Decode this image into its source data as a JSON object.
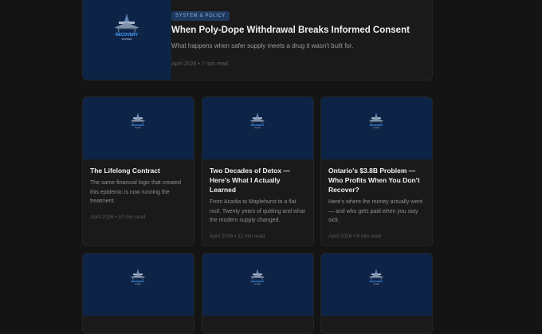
{
  "logo": {
    "wordmark": "RECOVERY",
    "sub": "ROOFER"
  },
  "featured": {
    "badge": "SYSTEM & POLICY",
    "title": "When Poly-Dope Withdrawal Breaks Informed Consent",
    "excerpt": "What happens when safer supply meets a drug it wasn't built for.",
    "meta": "April 2026 • 7 min read"
  },
  "cards": [
    {
      "title": "The Lifelong Contract",
      "excerpt": "The same financial logic that created this epidemic is now running the treatment.",
      "meta": "April 2026 • 10 min read"
    },
    {
      "title": "Two Decades of Detox — Here's What I Actually Learned",
      "excerpt": "From Acadia to Maplehurst to a flat roof. Twenty years of quitting and what the modern supply changed.",
      "meta": "April 2026 • 11 min read"
    },
    {
      "title": "Ontario's $3.8B Problem — Who Profits When You Don't Recover?",
      "excerpt": "Here's where the money actually went — and who gets paid when you stay sick.",
      "meta": "April 2026 • 9 min read"
    }
  ],
  "colors": {
    "background": "#141414",
    "card": "#1a1a1a",
    "thumb": "#0d2447",
    "accent": "#4da3ff"
  }
}
